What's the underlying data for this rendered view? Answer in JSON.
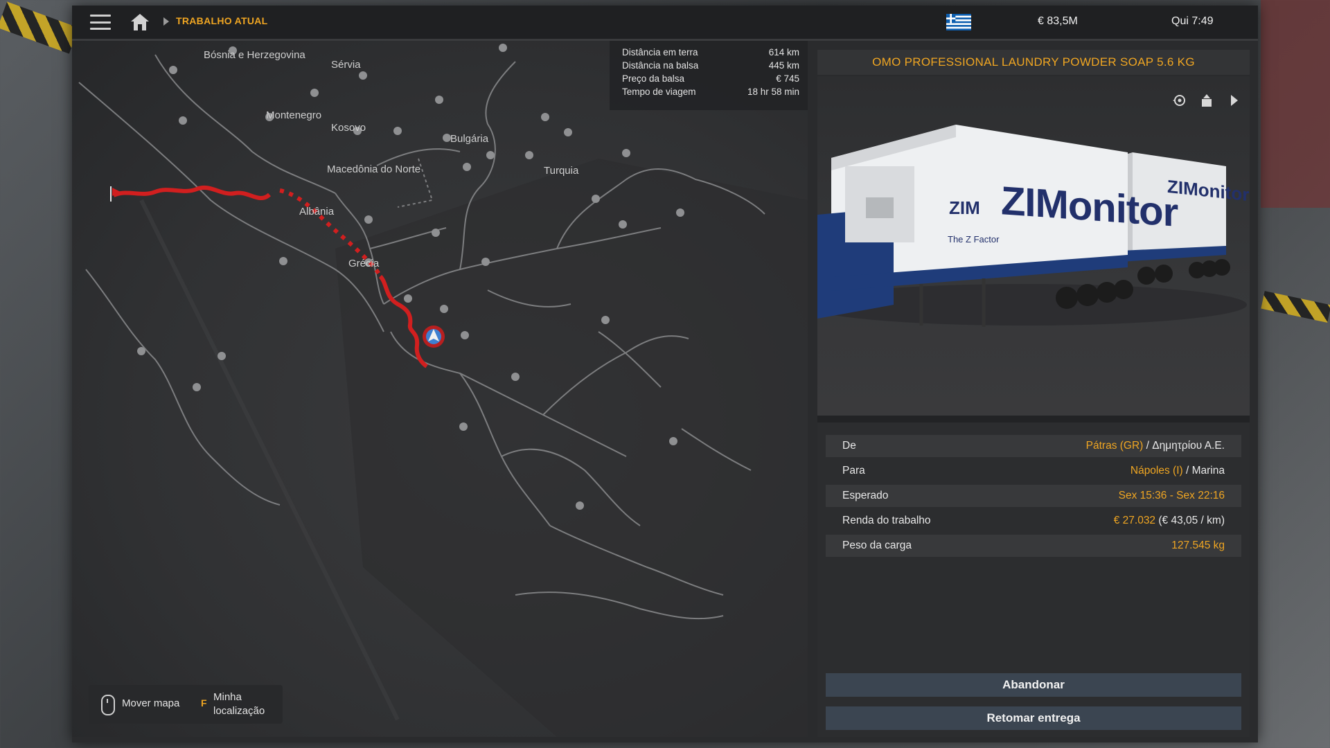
{
  "topbar": {
    "breadcrumb": "TRABALHO ATUAL",
    "money": "€ 83,5M",
    "time": "Qui 7:49",
    "icons": [
      "menu-icon",
      "home-icon",
      "greece-flag-icon"
    ]
  },
  "map": {
    "labels": {
      "bosnia": "Bósnia e Herzegovina",
      "serbia": "Sérvia",
      "montenegro": "Montenegro",
      "kosovo": "Kosovo",
      "bulgaria": "Bulgária",
      "macedonia": "Macedônia do Norte",
      "turkey": "Turquia",
      "albania": "Albânia",
      "greece": "Grécia"
    },
    "route_info": [
      {
        "label": "Distância em terra",
        "value": "614 km"
      },
      {
        "label": "Distância na balsa",
        "value": "445 km"
      },
      {
        "label": "Preço da balsa",
        "value": "€ 745"
      },
      {
        "label": "Tempo de viagem",
        "value": "18 hr 58 min"
      }
    ],
    "hints": {
      "move": "Mover mapa",
      "key": "F",
      "location": "Minha localização"
    },
    "colors": {
      "route": "#d11f1f",
      "accent": "#f0a622"
    }
  },
  "cargo": {
    "title": "OMO PROFESSIONAL LAUNDRY POWDER SOAP 5.6 KG",
    "trailer_brand": "ZIMonitor",
    "trailer_small": "ZIM",
    "trailer_tag": "The Z Factor",
    "preview_icons": [
      "rotate-view-icon",
      "upload-icon",
      "next-arrow-icon"
    ]
  },
  "details": {
    "rows": [
      {
        "key": "De",
        "value": "Pátras (GR)",
        "extra": " / Δημητρίου Α.Ε."
      },
      {
        "key": "Para",
        "value": "Nápoles (I)",
        "extra": " / Marina"
      },
      {
        "key": "Esperado",
        "value": "Sex 15:36 - Sex 22:16",
        "extra": ""
      },
      {
        "key": "Renda do trabalho",
        "value": "€ 27.032",
        "extra": " (€ 43,05 / km)"
      },
      {
        "key": "Peso da carga",
        "value": "127.545 kg",
        "extra": ""
      }
    ]
  },
  "actions": {
    "abandon": "Abandonar",
    "resume": "Retomar entrega"
  }
}
